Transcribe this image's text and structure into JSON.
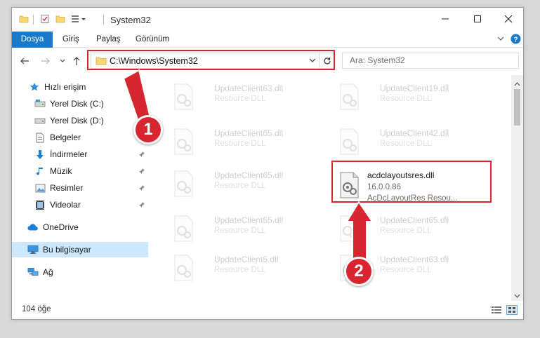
{
  "window": {
    "title": "System32"
  },
  "ribbon": {
    "tabs": [
      "Dosya",
      "Giriş",
      "Paylaş",
      "Görünüm"
    ]
  },
  "address": {
    "path": "C:\\Windows\\System32"
  },
  "search": {
    "placeholder": "Ara: System32"
  },
  "nav": {
    "quick_access": "Hızlı erişim",
    "items": [
      {
        "label": "Yerel Disk (C:)",
        "icon": "drive-icon",
        "pinned": true
      },
      {
        "label": "Yerel Disk (D:)",
        "icon": "drive-icon",
        "pinned": false
      },
      {
        "label": "Belgeler",
        "icon": "documents-icon",
        "pinned": true
      },
      {
        "label": "İndirmeler",
        "icon": "downloads-icon",
        "pinned": true
      },
      {
        "label": "Müzik",
        "icon": "music-icon",
        "pinned": true
      },
      {
        "label": "Resimler",
        "icon": "pictures-icon",
        "pinned": true
      },
      {
        "label": "Videolar",
        "icon": "videos-icon",
        "pinned": true
      }
    ],
    "onedrive": "OneDrive",
    "this_pc": "Bu bilgisayar",
    "network": "Ağ"
  },
  "files": {
    "left": [
      {
        "name": "UpdateClient63.dll",
        "type": "Resource DLL"
      },
      {
        "name": "UpdateClient65.dll",
        "type": "Resource DLL"
      },
      {
        "name": "UpdateClient65.dll",
        "type": "Resource DLL"
      },
      {
        "name": "UpdateClient55.dll",
        "type": "Resource DLL"
      },
      {
        "name": "UpdateClient5.dll",
        "type": "Resource DLL"
      }
    ],
    "right": [
      {
        "name": "UpdateClient19.dll",
        "type": "Resource DLL"
      },
      {
        "name": "UpdateClient42.dll",
        "type": "Resource DLL"
      },
      {
        "name": "UpdateClient65.dll",
        "type": "Resource DLL"
      },
      {
        "name": "UpdateClient63.dll",
        "type": "Resource DLL"
      }
    ],
    "highlighted": {
      "name": "acdclayoutsres.dll",
      "version": "16.0.0.86",
      "description": "AcDcLayoutRes Resou..."
    }
  },
  "status": {
    "count": "104 öğe"
  },
  "callouts": {
    "one": "1",
    "two": "2"
  },
  "colors": {
    "accent": "#1979ca",
    "highlight": "#d7262f",
    "selection": "#cce8ff"
  }
}
